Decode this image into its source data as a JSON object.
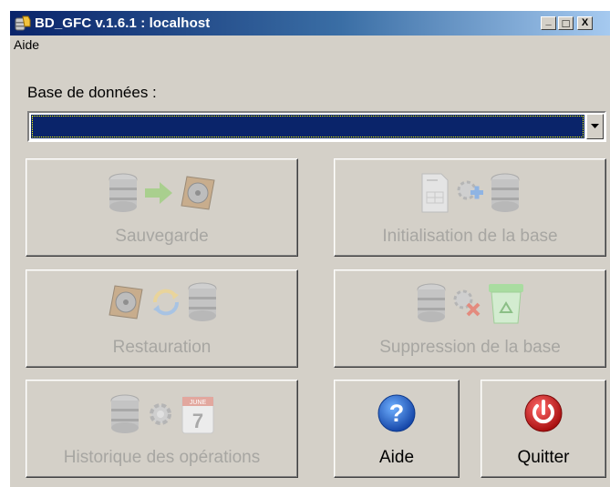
{
  "window": {
    "title": "BD_GFC v.1.6.1 : localhost",
    "controls": {
      "minimize": "_",
      "maximize": "□",
      "close": "X"
    }
  },
  "menu": {
    "items": [
      "Aide"
    ]
  },
  "database": {
    "label": "Base de données :",
    "selected_value": ""
  },
  "buttons": {
    "sauvegarde": {
      "label": "Sauvegarde",
      "enabled": false,
      "icons": [
        "database-icon",
        "arrow-right-icon",
        "hard-drive-icon"
      ]
    },
    "initialisation": {
      "label": "Initialisation de la base",
      "enabled": false,
      "icons": [
        "document-icon",
        "gear-plus-icon",
        "database-icon"
      ]
    },
    "restauration": {
      "label": "Restauration",
      "enabled": false,
      "icons": [
        "hard-drive-icon",
        "refresh-icon",
        "database-icon"
      ]
    },
    "suppression": {
      "label": "Suppression de la base",
      "enabled": false,
      "icons": [
        "database-icon",
        "gear-delete-icon",
        "recycle-bin-icon"
      ]
    },
    "historique": {
      "label": "Historique des opérations",
      "enabled": false,
      "icons": [
        "database-icon",
        "gear-icon",
        "calendar-icon"
      ]
    },
    "aide": {
      "label": "Aide",
      "enabled": true,
      "icons": [
        "help-icon"
      ]
    },
    "quitter": {
      "label": "Quitter",
      "enabled": true,
      "icons": [
        "power-icon"
      ]
    }
  },
  "calendar_icon": {
    "month": "JUNE",
    "day": "7"
  },
  "colors": {
    "window_bg": "#d4d0c8",
    "title_active": "#0a246a",
    "disabled_text": "#a7a6a2",
    "help_blue": "#1e5fc8",
    "quit_red": "#c81e1e"
  }
}
